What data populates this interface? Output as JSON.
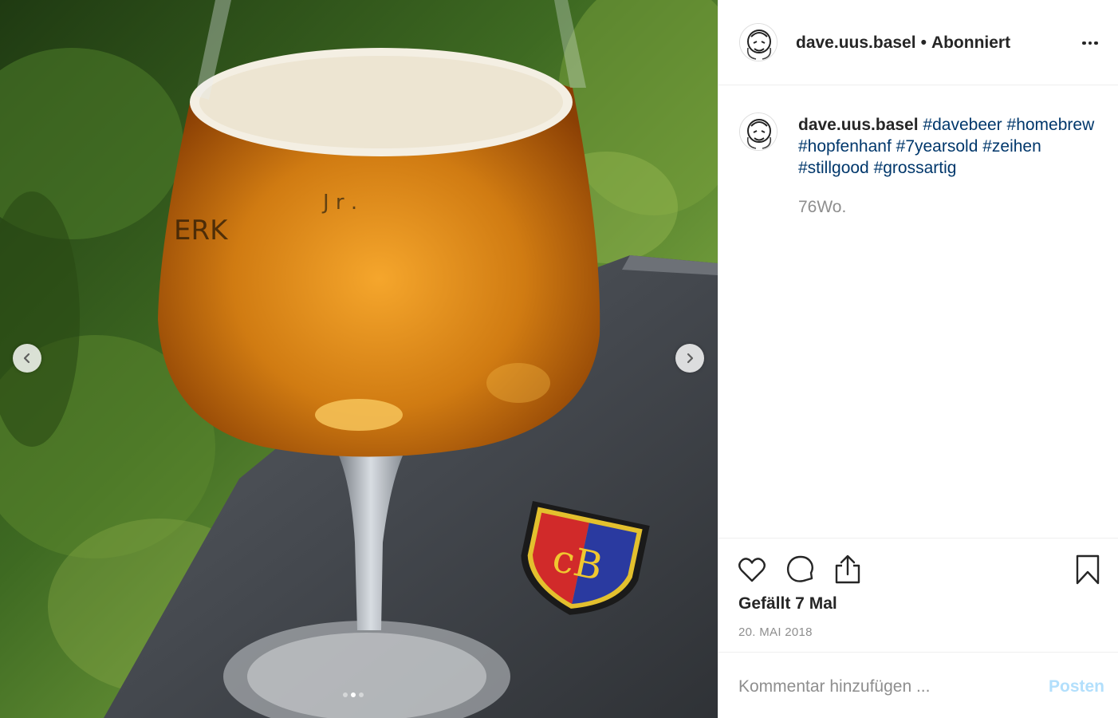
{
  "post": {
    "username": "dave.uus.basel",
    "separator": "•",
    "follow_status": "Abonniert",
    "caption_user": "dave.uus.basel",
    "hashtags": [
      "#davebeer",
      "#homebrew",
      "#hopfenhanf",
      "#7yearsold",
      "#zeihen",
      "#stillgood",
      "#grossartig"
    ],
    "age": "76Wo.",
    "likes": "Gefällt 7 Mal",
    "date": "20. MAI 2018"
  },
  "comment": {
    "placeholder": "Kommentar hinzufügen ...",
    "post_label": "Posten"
  },
  "carousel": {
    "slide_count": 3,
    "active_index": 1
  },
  "icons": {
    "more": "more-options-icon",
    "like": "heart-icon",
    "comment": "comment-icon",
    "share": "share-icon",
    "save": "bookmark-icon",
    "prev": "chevron-left-icon",
    "next": "chevron-right-icon"
  },
  "colors": {
    "hashtag": "#00376b",
    "muted": "#8e8e8e",
    "post_button_disabled": "#b2dffc"
  }
}
